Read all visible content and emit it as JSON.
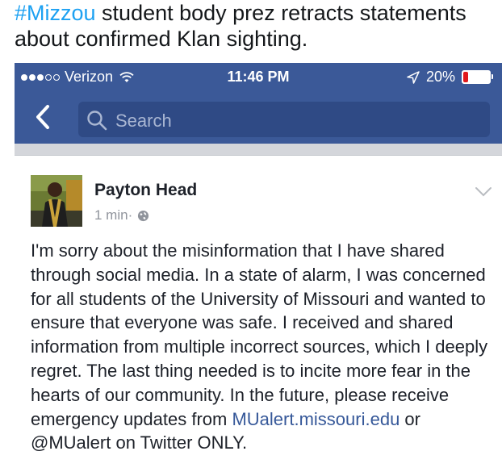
{
  "tweet": {
    "hashtag": "#Mizzou",
    "text_rest": " student body prez retracts statements about confirmed Klan sighting."
  },
  "status_bar": {
    "carrier": "Verizon",
    "time": "11:46 PM",
    "battery": "20%",
    "battery_level": 0.2,
    "signal_bars_filled": 3,
    "signal_bars_total": 5
  },
  "nav": {
    "search_placeholder": "Search"
  },
  "post": {
    "author": "Payton Head",
    "time": "1 min",
    "separator": " · ",
    "body_part1": "I'm sorry about the misinformation that I have shared through social media. In a state of alarm, I was concerned for all students of the University of Missouri and wanted to ensure that everyone was safe. I received and shared information from multiple incorrect sources, which I deeply regret. The last thing needed is to incite more fear in the hearts of our community. In the future, please receive emergency updates from ",
    "link": "MUalert.missouri.edu",
    "body_part2": " or @MUalert on Twitter ONLY."
  },
  "colors": {
    "facebook_blue": "#3b5998",
    "hashtag_blue": "#1da1f2",
    "link_blue": "#365899",
    "battery_red": "#e0191c"
  }
}
